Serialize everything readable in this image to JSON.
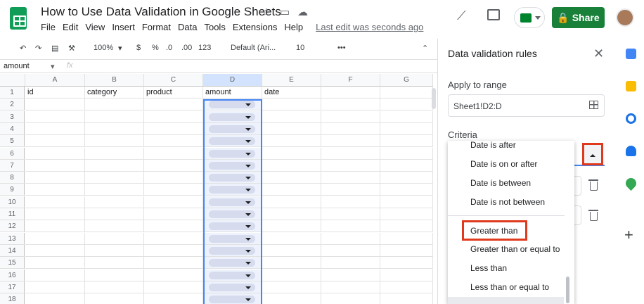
{
  "header": {
    "title": "How to Use Data Validation in Google Sheets",
    "menu": [
      "File",
      "Edit",
      "View",
      "Insert",
      "Format",
      "Data",
      "Tools",
      "Extensions",
      "Help"
    ],
    "last_edit": "Last edit was seconds ago",
    "share_label": "Share"
  },
  "toolbar": {
    "zoom": "100%",
    "currency": "$",
    "percent": "%",
    "dec_decrease": ".0",
    "dec_increase": ".00",
    "number_format": "123",
    "font": "Default (Ari...",
    "font_size": "10",
    "more": "•••"
  },
  "formula_bar": {
    "name_box": "amount",
    "fx": "fx"
  },
  "grid": {
    "columns": [
      "A",
      "B",
      "C",
      "D",
      "E",
      "F",
      "G"
    ],
    "row_numbers": [
      "1",
      "2",
      "3",
      "4",
      "5",
      "6",
      "7",
      "8",
      "9",
      "10",
      "11",
      "12",
      "13",
      "14",
      "15",
      "16",
      "17",
      "18"
    ],
    "header_row": [
      "id",
      "category",
      "product",
      "amount",
      "date",
      "",
      ""
    ]
  },
  "panel": {
    "title": "Data validation rules",
    "apply_to_range_label": "Apply to range",
    "range_value": "Sheet1!D2:D",
    "criteria_label": "Criteria",
    "options": [
      "Date is after",
      "Date is on or after",
      "Date is between",
      "Date is not between",
      "Greater than",
      "Greater than or equal to",
      "Less than",
      "Less than or equal to"
    ],
    "highlighted_option": "Greater than"
  },
  "colors": {
    "accent": "#188038",
    "selection": "#4285f4",
    "highlight": "#e03a1e",
    "chip": "#d6dbee"
  }
}
